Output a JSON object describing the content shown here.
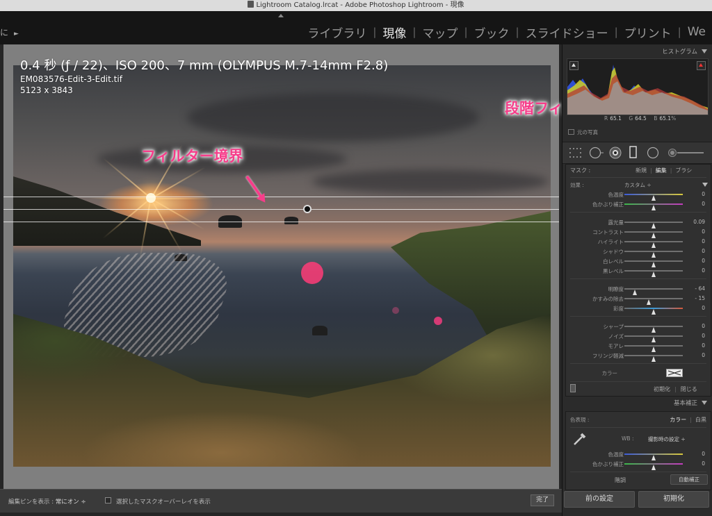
{
  "window": {
    "title": "Lightroom Catalog.lrcat - Adobe Photoshop Lightroom - 現像"
  },
  "topbar": {
    "left_fragment": "に",
    "left_play": "►"
  },
  "modules": [
    {
      "label": "ライブラリ",
      "active": false
    },
    {
      "label": "現像",
      "active": true
    },
    {
      "label": "マップ",
      "active": false
    },
    {
      "label": "ブック",
      "active": false
    },
    {
      "label": "スライドショー",
      "active": false
    },
    {
      "label": "プリント",
      "active": false
    },
    {
      "label": "We",
      "active": false
    }
  ],
  "photo_info": {
    "exposure_line": "0.4 秒 (ƒ / 22)、ISO 200、7 mm (OLYMPUS M.7-14mm F2.8)",
    "filename": "EM083576-Edit-3-Edit.tif",
    "dimensions": "5123 x 3843"
  },
  "annotations": {
    "filter_boundary": "フィルター境界",
    "graduated_filter": "段階フィルター"
  },
  "toolbar": {
    "show_pins_label": "編集ピンを表示 :",
    "show_pins_value": "常にオン ÷",
    "overlay_label": "選択したマスクオーバーレイを表示",
    "done": "完了"
  },
  "histogram": {
    "header": "ヒストグラム",
    "r_label": "R",
    "r_value": "65.1",
    "g_label": "G",
    "g_value": "64.5",
    "b_label": "B",
    "b_value": "65.1",
    "b_unit": "%",
    "original_photo": "元の写真"
  },
  "mask": {
    "label": "マスク :",
    "new": "新規",
    "edit": "編集",
    "brush": "ブラシ",
    "effect_label": "効果 :",
    "effect_value": "カスタム ÷",
    "sliders": [
      {
        "label": "色温度",
        "value": "0",
        "pos": 0.5
      },
      {
        "label": "色かぶり補正",
        "value": "0",
        "pos": 0.5
      },
      {
        "label": "露光量",
        "value": "0.09",
        "pos": 0.51
      },
      {
        "label": "コントラスト",
        "value": "0",
        "pos": 0.5
      },
      {
        "label": "ハイライト",
        "value": "0",
        "pos": 0.5
      },
      {
        "label": "シャドウ",
        "value": "0",
        "pos": 0.5
      },
      {
        "label": "白レベル",
        "value": "0",
        "pos": 0.5
      },
      {
        "label": "黒レベル",
        "value": "0",
        "pos": 0.5
      },
      {
        "label": "明瞭度",
        "value": "- 64",
        "pos": 0.18
      },
      {
        "label": "かすみの除去",
        "value": "- 15",
        "pos": 0.42
      },
      {
        "label": "彩度",
        "value": "0",
        "pos": 0.5
      },
      {
        "label": "シャープ",
        "value": "0",
        "pos": 0.5
      },
      {
        "label": "ノイズ",
        "value": "0",
        "pos": 0.5
      },
      {
        "label": "モアレ",
        "value": "0",
        "pos": 0.5
      },
      {
        "label": "フリンジ軽減",
        "value": "0",
        "pos": 0.5
      }
    ],
    "color_label": "カラー",
    "reset": "初期化",
    "close": "閉じる"
  },
  "basic": {
    "header": "基本補正",
    "treatment_label": "色表現 :",
    "color": "カラー",
    "bw": "白黒",
    "wb_label": "WB :",
    "wb_value": "撮影時の設定 ÷",
    "sliders": [
      {
        "label": "色温度",
        "value": "0",
        "pos": 0.5
      },
      {
        "label": "色かぶり補正",
        "value": "0",
        "pos": 0.5
      }
    ],
    "tone_label": "階調",
    "auto": "自動補正"
  },
  "bottom_buttons": {
    "previous": "前の設定",
    "reset": "初期化"
  }
}
